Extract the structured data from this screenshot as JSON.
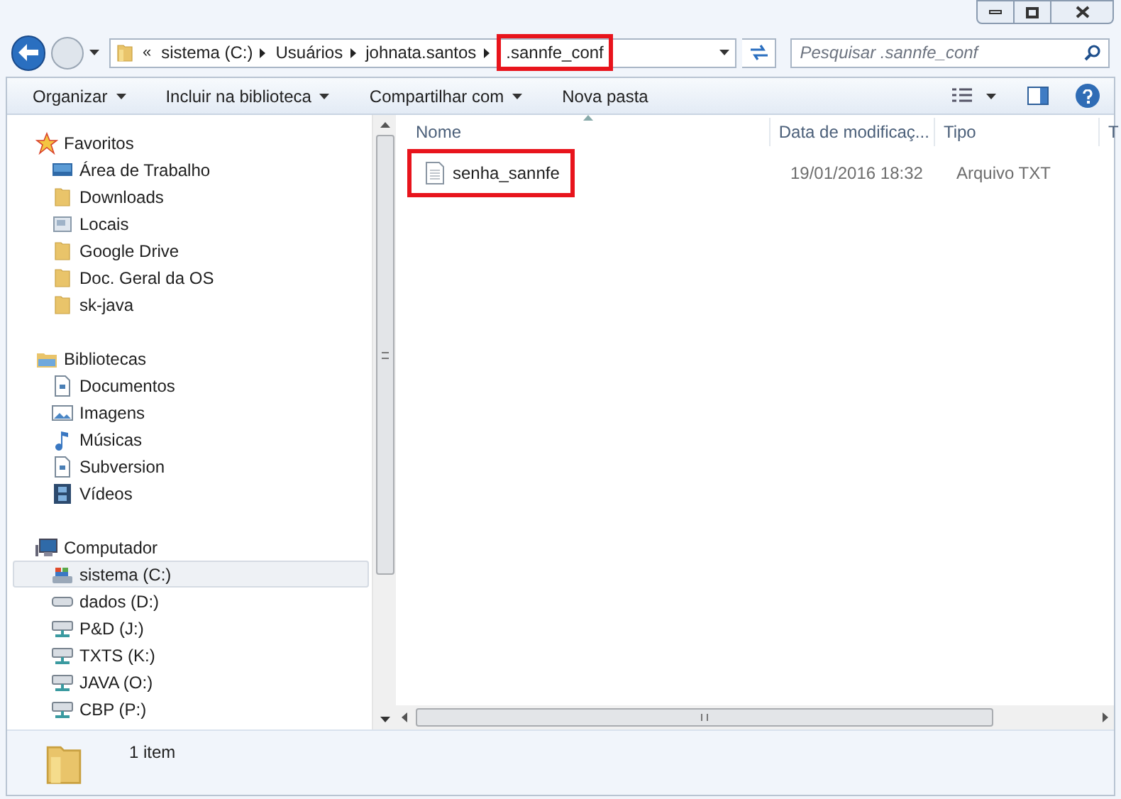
{
  "address_bar": {
    "overflow": "«",
    "segments": [
      {
        "label": "sistema (C:)",
        "highlighted": false
      },
      {
        "label": "Usuários",
        "highlighted": false
      },
      {
        "label": "johnata.santos",
        "highlighted": false
      },
      {
        "label": ".sannfe_conf",
        "highlighted": true
      }
    ]
  },
  "search": {
    "placeholder": "Pesquisar .sannfe_conf"
  },
  "toolbar": {
    "items": [
      {
        "label": "Organizar",
        "dropdown": true
      },
      {
        "label": "Incluir na biblioteca",
        "dropdown": true
      },
      {
        "label": "Compartilhar com",
        "dropdown": true
      },
      {
        "label": "Nova pasta",
        "dropdown": false
      }
    ]
  },
  "navigation": {
    "sections": [
      {
        "label": "Favoritos",
        "kind": "star",
        "children": [
          {
            "label": "Área de Trabalho",
            "kind": "desktop",
            "selected": false
          },
          {
            "label": "Downloads",
            "kind": "folder",
            "selected": false
          },
          {
            "label": "Locais",
            "kind": "places",
            "selected": false
          },
          {
            "label": "Google Drive",
            "kind": "folder",
            "selected": false
          },
          {
            "label": "Doc. Geral da OS",
            "kind": "folder",
            "selected": false
          },
          {
            "label": "sk-java",
            "kind": "folder",
            "selected": false
          }
        ]
      },
      {
        "label": "Bibliotecas",
        "kind": "library",
        "children": [
          {
            "label": "Documentos",
            "kind": "document",
            "selected": false
          },
          {
            "label": "Imagens",
            "kind": "image",
            "selected": false
          },
          {
            "label": "Músicas",
            "kind": "music",
            "selected": false
          },
          {
            "label": "Subversion",
            "kind": "document",
            "selected": false
          },
          {
            "label": "Vídeos",
            "kind": "video",
            "selected": false
          }
        ]
      },
      {
        "label": "Computador",
        "kind": "computer",
        "children": [
          {
            "label": "sistema (C:)",
            "kind": "system-drive",
            "selected": true
          },
          {
            "label": "dados (D:)",
            "kind": "drive",
            "selected": false
          },
          {
            "label": "P&D (J:)",
            "kind": "network-drive",
            "selected": false
          },
          {
            "label": "TXTS (K:)",
            "kind": "network-drive",
            "selected": false
          },
          {
            "label": "JAVA (O:)",
            "kind": "network-drive",
            "selected": false
          },
          {
            "label": "CBP (P:)",
            "kind": "network-drive",
            "selected": false
          }
        ]
      }
    ]
  },
  "file_list": {
    "columns": [
      "Nome",
      "Data de modificaç...",
      "Tipo",
      "T"
    ],
    "rows": [
      {
        "name": "senha_sannfe",
        "modified": "19/01/2016 18:32",
        "type": "Arquivo TXT",
        "highlighted": true
      }
    ]
  },
  "status_bar": {
    "count": "1 item"
  }
}
